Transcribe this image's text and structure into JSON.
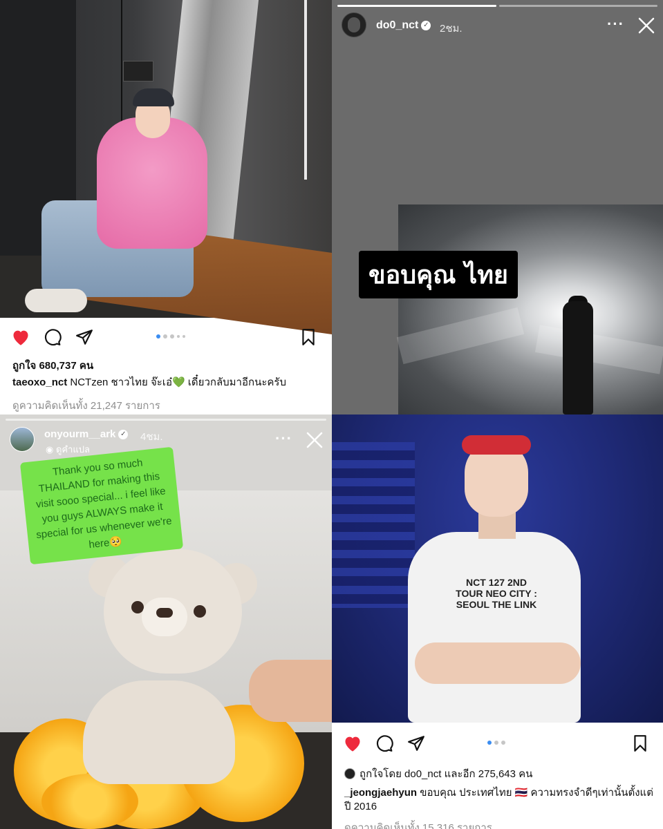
{
  "post1": {
    "likes": "ถูกใจ 680,737 คน",
    "username": "taeoxo_nct",
    "caption": " NCTzen ชาวไทย จ๊ะเอ๋💚 เดี๋ยวกลับมาอีกนะครับ",
    "comments": "ดูความคิดเห็นทั้ง 21,247 รายการ",
    "carousel": {
      "count": 5,
      "active": 0
    }
  },
  "story1": {
    "username": "do0_nct",
    "time": "2ชม.",
    "label": "ขอบคุณ ไทย",
    "progress": {
      "segments": 2,
      "active": 1
    }
  },
  "story2": {
    "username": "onyourm__ark",
    "time": "4ชม.",
    "translate": "ดูคำแปล",
    "note": "Thank you so much THAILAND for making this visit sooo special... i feel like you guys ALWAYS make it special for us whenever we're here🥺"
  },
  "post2": {
    "likes": "ถูกใจโดย do0_nct และอีก 275,643 คน",
    "username": "_jeongjaehyun",
    "caption": " ขอบคุณ ประเทศไทย 🇹🇭 ความทรงจำดีๆเท่านั้นตั้งแต่ปี 2016",
    "comments": "ดูความคิดเห็นทั้ง 15,316 รายการ",
    "shirt": "NCT 127 2ND TOUR NEO CITY : SEOUL THE LINK",
    "carousel": {
      "count": 3,
      "active": 0
    }
  },
  "colors": {
    "like": "#ee2a3c",
    "accent": "#3b8df1",
    "note_bg": "#76e24a"
  },
  "icons": [
    "heart-icon",
    "comment-icon",
    "share-icon",
    "bookmark-icon",
    "more-icon",
    "close-icon",
    "verified-icon",
    "translate-icon"
  ]
}
